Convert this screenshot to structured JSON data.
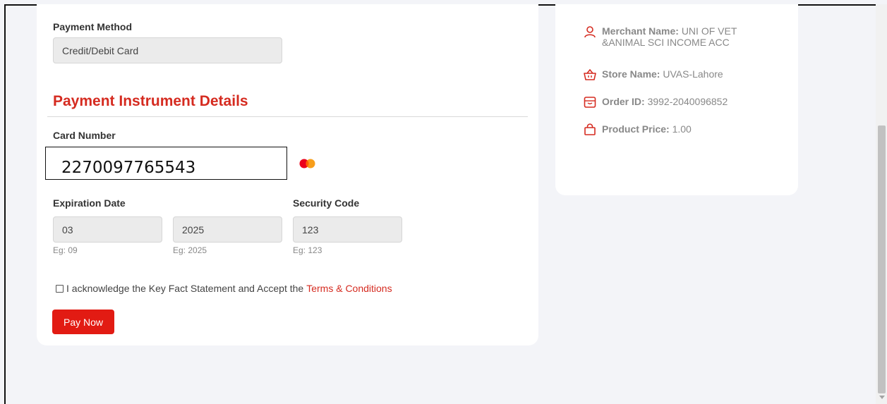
{
  "payment": {
    "method_label": "Payment Method",
    "method_value": "Credit/Debit Card",
    "section_title": "Payment Instrument Details",
    "card_number_label": "Card Number",
    "card_number_value": "2270097765543",
    "expiration_label": "Expiration Date",
    "exp_month_value": "03",
    "exp_month_hint": "Eg: 09",
    "exp_year_value": "2025",
    "exp_year_hint": "Eg: 2025",
    "security_label": "Security Code",
    "security_value": "123",
    "security_hint": "Eg: 123",
    "ack_text": "I acknowledge the Key Fact Statement and Accept the",
    "terms_link": "Terms & Conditions",
    "pay_button": "Pay Now"
  },
  "order": {
    "merchant_key": "Merchant Name:",
    "merchant_value": "UNI OF VET &ANIMAL SCI INCOME ACC",
    "store_key": "Store Name:",
    "store_value": "UVAS-Lahore",
    "order_key": "Order ID:",
    "order_value": "3992-2040096852",
    "price_key": "Product Price:",
    "price_value": "1.00"
  },
  "icons": {
    "card_brand": "mastercard-icon",
    "merchant": "user-icon",
    "store": "basket-icon",
    "order": "inbox-icon",
    "price": "shopping-bag-icon"
  },
  "colors": {
    "accent": "#d52b20",
    "button": "#e21b13",
    "background": "#f3f4f8"
  }
}
